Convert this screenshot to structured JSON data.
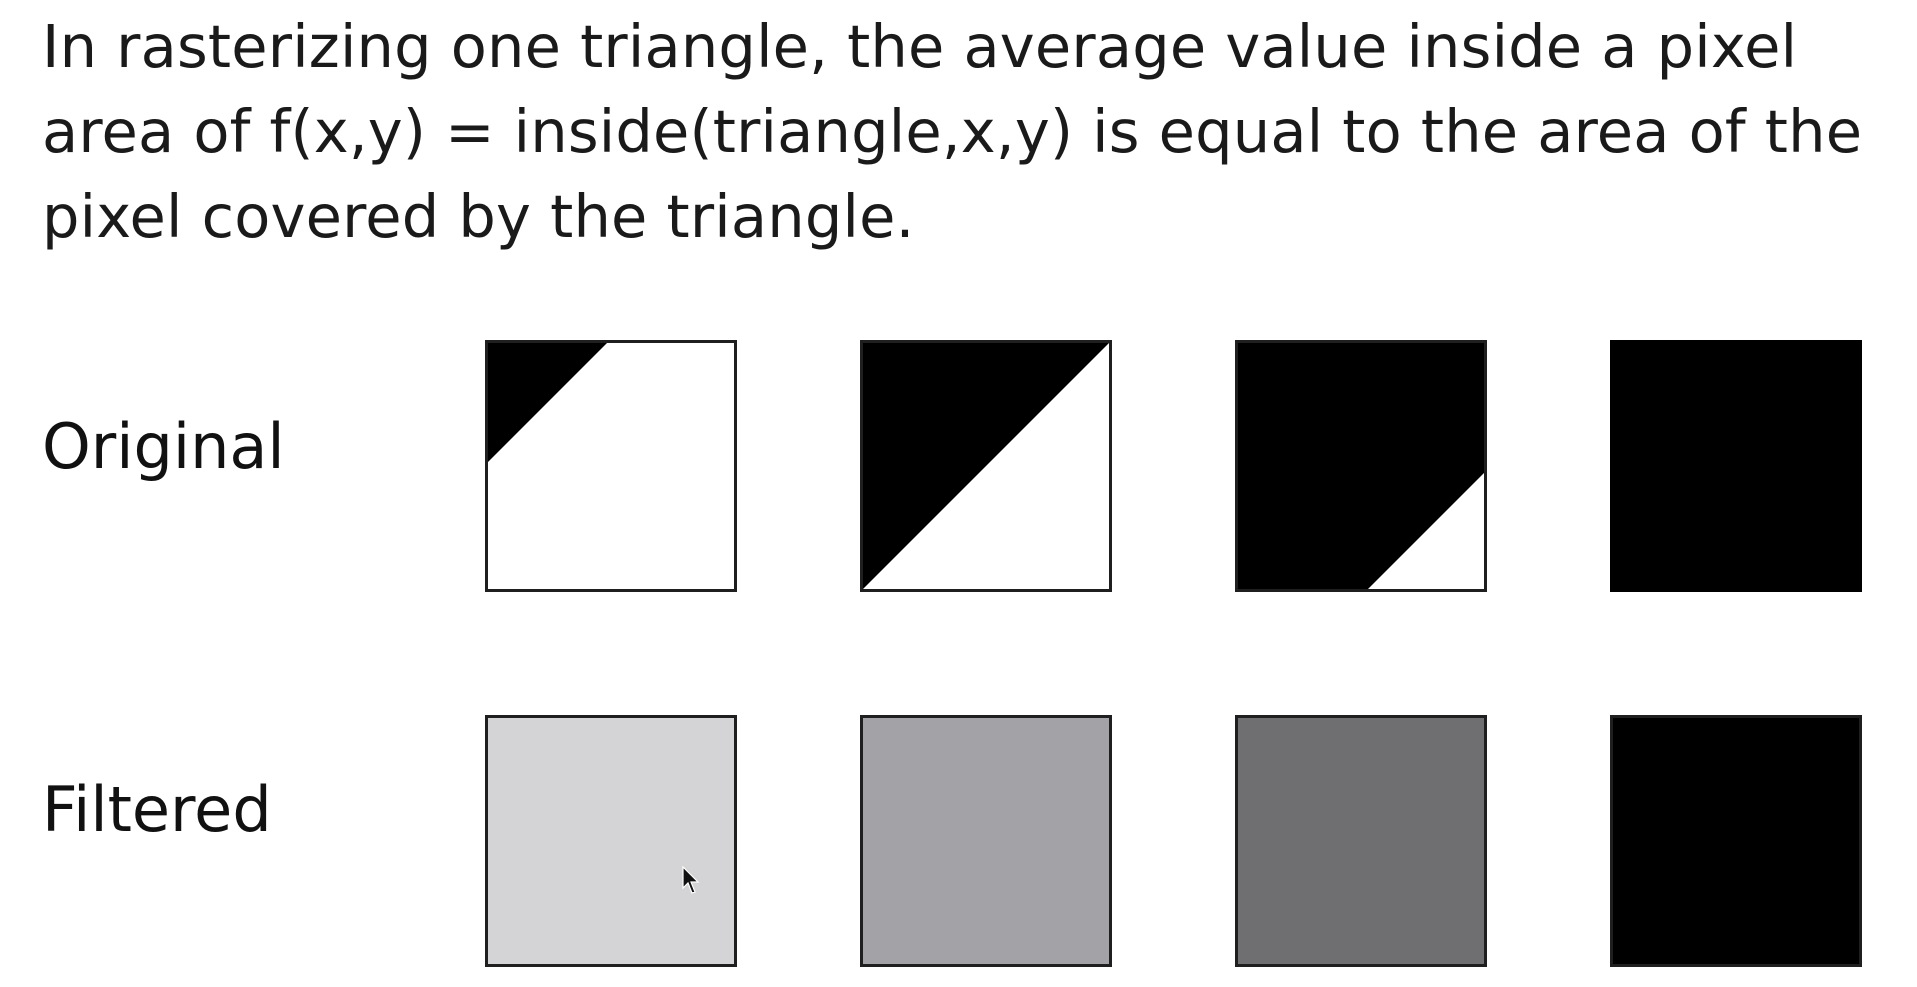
{
  "statement": {
    "lines": [
      "In rasterizing one triangle, the average value inside a pixel",
      "area of f(x,y) = inside(triangle,x,y) is equal to the area of the",
      "pixel covered by the triangle."
    ]
  },
  "rows": {
    "original_label": "Original",
    "filtered_label": "Filtered"
  },
  "cells": [
    {
      "covered_fraction": 0.12,
      "filtered_color": "#d4d4d6"
    },
    {
      "covered_fraction": 0.5,
      "filtered_color": "#a3a3a7"
    },
    {
      "covered_fraction": 0.87,
      "filtered_color": "#6f6e71"
    },
    {
      "covered_fraction": 1.0,
      "filtered_color": "#000000"
    }
  ],
  "colors": {
    "background": "#ffffff",
    "triangle_fill": "#000000",
    "border": "#1f1f1f"
  }
}
